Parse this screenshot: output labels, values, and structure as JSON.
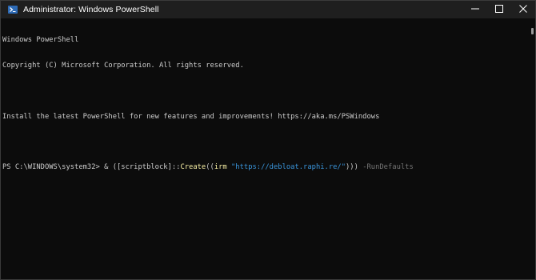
{
  "window": {
    "title": "Administrator: Windows PowerShell",
    "app_icon": "powershell-icon",
    "controls": [
      "minimize-icon",
      "maximize-icon",
      "close-icon"
    ]
  },
  "console": {
    "header_line1": "Windows PowerShell",
    "header_line2": "Copyright (C) Microsoft Corporation. All rights reserved.",
    "install_notice": "Install the latest PowerShell for new features and improvements! https://aka.ms/PSWindows",
    "prompt": "PS C:\\WINDOWS\\system32> ",
    "command": {
      "part1": "& ([scriptblock]::",
      "part2_create": "Create",
      "part3": "((",
      "part4_irm": "irm",
      "part5_space": " ",
      "part6_url": "\"https://debloat.raphi.re/\"",
      "part7": "))) ",
      "part8_param": "-RunDefaults"
    }
  },
  "colors": {
    "background": "#0c0c0c",
    "titlebar": "#1f1f1f",
    "text": "#cccccc",
    "yellow": "#f9f1a5",
    "string": "#3a96dd",
    "param": "#767676"
  }
}
